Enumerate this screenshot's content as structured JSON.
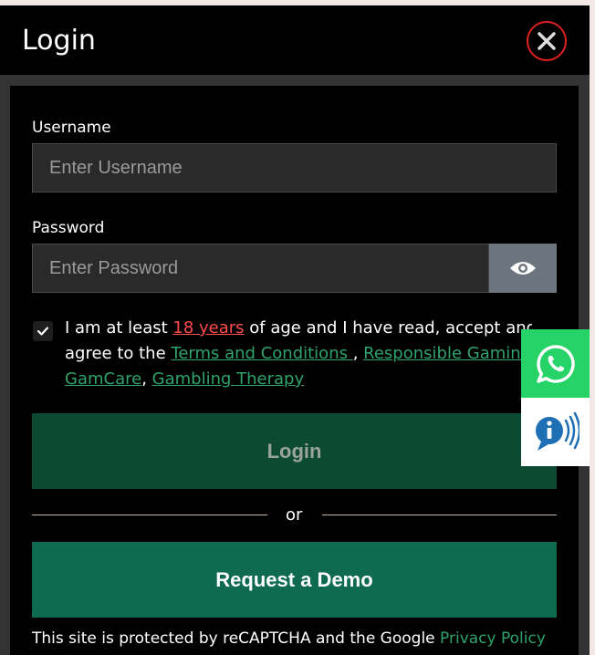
{
  "modal": {
    "title": "Login",
    "close_icon": "close-icon"
  },
  "form": {
    "username_label": "Username",
    "username_placeholder": "Enter Username",
    "password_label": "Password",
    "password_placeholder": "Enter Password",
    "show_password_icon": "eye-icon",
    "consent_checked": true,
    "consent": {
      "text_1": "I am at least ",
      "age_link": "18 years",
      "text_2": " of age and I have read, accept and",
      "text_3": "agree to the ",
      "terms_link": "Terms and Conditions ",
      "sep_1": ", ",
      "responsible_link": "Responsible Gaming",
      "gamcare_link": "GamCare",
      "sep_2": ", ",
      "therapy_link": "Gambling Therapy"
    },
    "login_button": "Login",
    "or_text": "or",
    "demo_button": "Request a Demo",
    "recaptcha_text": "This site is protected by reCAPTCHA and the Google ",
    "privacy_link": "Privacy Policy"
  },
  "floating": {
    "whatsapp_icon": "whatsapp-icon",
    "info_icon": "info-sound-icon"
  },
  "colors": {
    "accent_green": "#0e6b4f",
    "link_green": "#2fa36b",
    "link_red": "#ff4d4d",
    "close_ring": "#e02020",
    "whatsapp": "#25d366"
  }
}
